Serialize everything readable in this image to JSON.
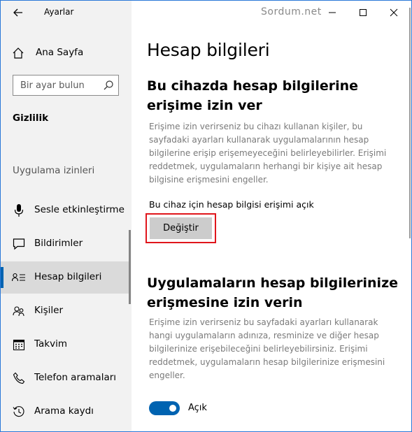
{
  "window": {
    "title": "Ayarlar",
    "watermark": "Sordum.net"
  },
  "sidebar": {
    "home_label": "Ana Sayfa",
    "search_placeholder": "Bir ayar bulun",
    "section_title": "Gizlilik",
    "group_label": "Uygulama izinleri",
    "items": [
      {
        "label": "Sesle etkinleştirme",
        "icon": "microphone-icon"
      },
      {
        "label": "Bildirimler",
        "icon": "notification-icon"
      },
      {
        "label": "Hesap bilgileri",
        "icon": "account-info-icon",
        "active": true
      },
      {
        "label": "Kişiler",
        "icon": "contacts-icon"
      },
      {
        "label": "Takvim",
        "icon": "calendar-icon"
      },
      {
        "label": "Telefon aramaları",
        "icon": "phone-icon"
      },
      {
        "label": "Arama kaydı",
        "icon": "history-icon"
      }
    ]
  },
  "main": {
    "page_title": "Hesap bilgileri",
    "section1": {
      "heading": "Bu cihazda hesap bilgilerine erişime izin ver",
      "description": "Erişime izin verirseniz bu cihazı kullanan kişiler, bu sayfadaki ayarları kullanarak uygulamalarının hesap bilgilerine erişip erişemeyeceğini belirleyebilirler. Erişimi reddetmek, uygulamaların herhangi bir kişiye ait hesap bilgisine erişmesini engeller.",
      "status": "Bu cihaz için hesap bilgisi erişimi açık",
      "button_label": "Değiştir"
    },
    "section2": {
      "heading": "Uygulamaların hesap bilgilerinize erişmesine izin verin",
      "description": "Erişime izin verirseniz bu sayfadaki ayarları kullanarak hangi uygulamaların adınıza, resminize ve diğer hesap bilgilerinize erişebileceğini belirleyebilirsiniz. Erişimi reddetmek, uygulamaların hesap bilgilerinize erişmesini engeller.",
      "toggle_label": "Açık",
      "toggle_on": true
    }
  },
  "colors": {
    "accent": "#0063b1",
    "highlight": "#e0161c",
    "sidebar_bg": "#f2f2f2"
  }
}
